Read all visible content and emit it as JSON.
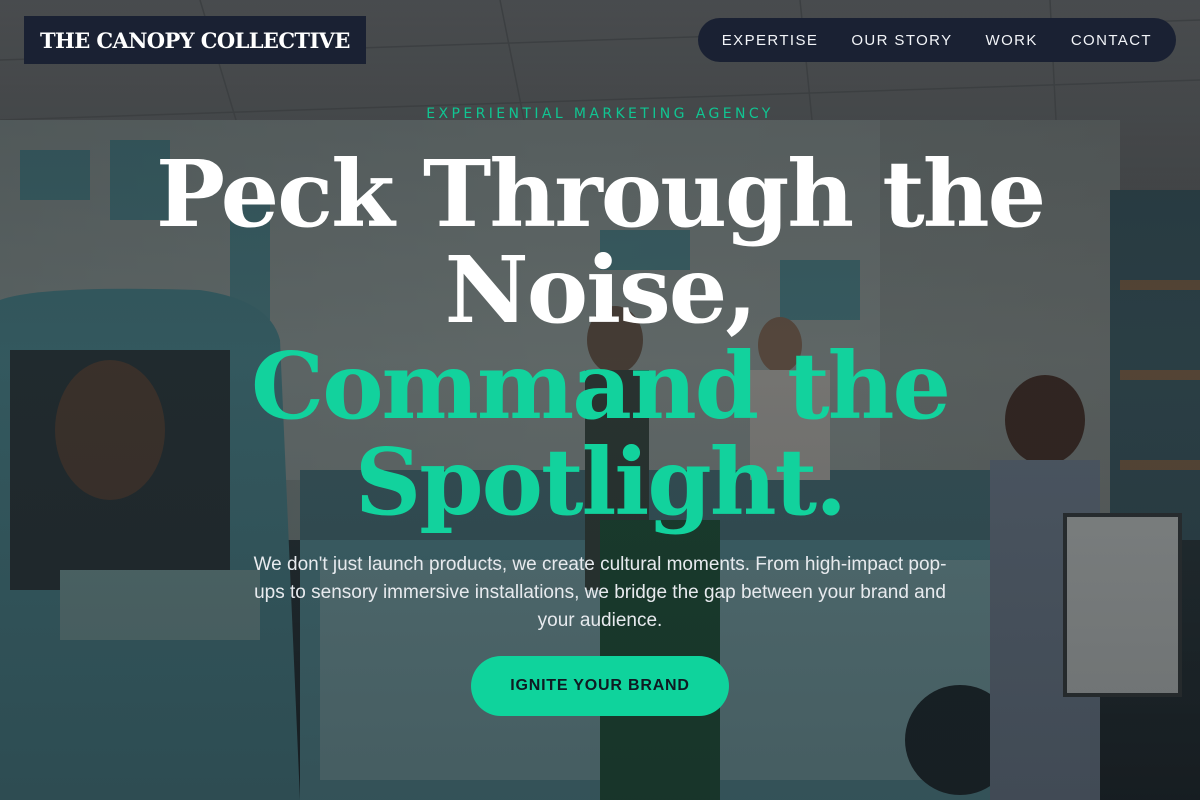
{
  "brand": {
    "logo_text": "THE CANOPY COLLECTIVE"
  },
  "nav": {
    "items": [
      {
        "label": "EXPERTISE"
      },
      {
        "label": "OUR STORY"
      },
      {
        "label": "WORK"
      },
      {
        "label": "CONTACT"
      }
    ]
  },
  "hero": {
    "eyebrow": "EXPERIENTIAL MARKETING AGENCY",
    "headline_line1": "Peck Through the Noise,",
    "headline_line2": "Command the Spotlight.",
    "subtext": "We don't just launch products, we create cultural moments. From high-impact pop-ups to sensory immersive installations, we bridge the gap between your brand and your audience.",
    "cta_label": "IGNITE YOUR BRAND"
  },
  "colors": {
    "accent": "#12d29d",
    "navy": "#1a2133",
    "text_light": "#e7eaee"
  },
  "background": {
    "icon": "pop-up-shop-photo"
  }
}
